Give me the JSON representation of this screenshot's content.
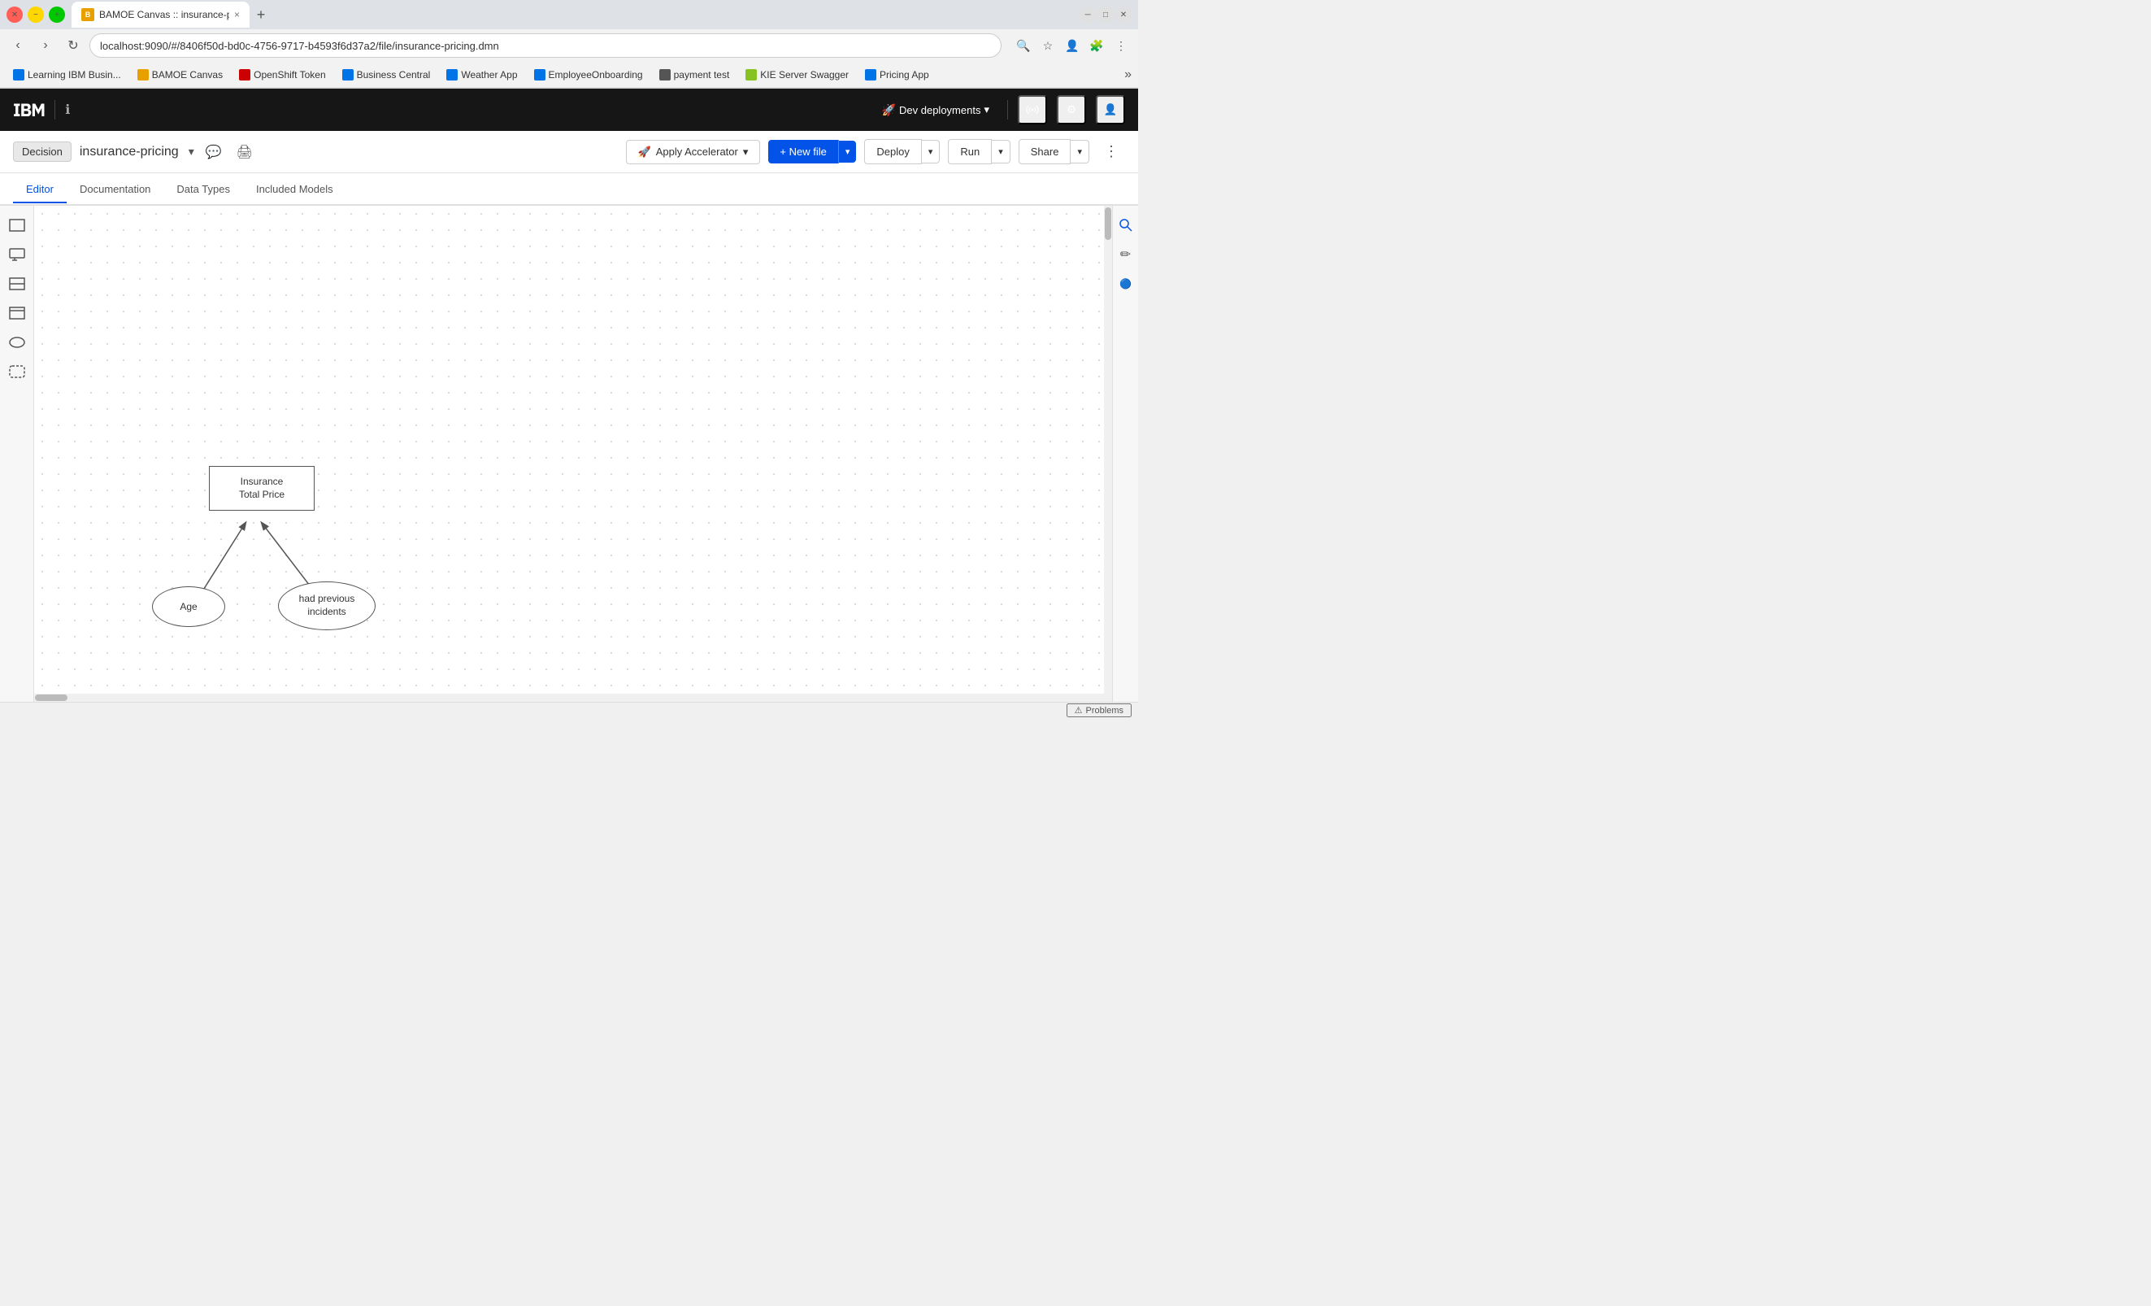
{
  "browser": {
    "tab": {
      "favicon_text": "B",
      "title": "BAMOE Canvas :: insurance-pri...",
      "close_label": "×"
    },
    "new_tab_label": "+",
    "address": "localhost:9090/#/8406f50d-bd0c-4756-9717-b4593f6d37a2/file/insurance-pricing.dmn",
    "nav": {
      "back": "‹",
      "forward": "›",
      "refresh": "↻"
    }
  },
  "bookmarks": [
    {
      "id": "learning",
      "label": "Learning IBM Busin...",
      "color": "#0073e6"
    },
    {
      "id": "bamoe",
      "label": "BAMOE Canvas",
      "color": "#e8a000"
    },
    {
      "id": "openshift",
      "label": "OpenShift Token",
      "color": "#cc0000"
    },
    {
      "id": "business",
      "label": "Business Central",
      "color": "#0073e6"
    },
    {
      "id": "weather",
      "label": "Weather App",
      "color": "#0073e6"
    },
    {
      "id": "employee",
      "label": "EmployeeOnboarding",
      "color": "#0073e6"
    },
    {
      "id": "payment",
      "label": "payment test",
      "color": "#555"
    },
    {
      "id": "kie",
      "label": "KIE Server Swagger",
      "color": "#85c222"
    },
    {
      "id": "pricing",
      "label": "Pricing App",
      "color": "#0073e6"
    }
  ],
  "app_header": {
    "logo": "IBM",
    "dev_deployments_label": "Dev deployments",
    "dev_deployments_caret": "▾"
  },
  "toolbar": {
    "decision_label": "Decision",
    "file_name": "insurance-pricing",
    "dropdown_caret": "▾",
    "accelerator_label": "Apply Accelerator",
    "accelerator_caret": "▾",
    "new_file_label": "+ New file",
    "new_file_caret": "▾",
    "deploy_label": "Deploy",
    "deploy_caret": "▾",
    "run_label": "Run",
    "run_caret": "▾",
    "share_label": "Share",
    "share_caret": "▾",
    "kebab": "⋮"
  },
  "tabs": [
    {
      "id": "editor",
      "label": "Editor",
      "active": true
    },
    {
      "id": "documentation",
      "label": "Documentation",
      "active": false
    },
    {
      "id": "datatypes",
      "label": "Data Types",
      "active": false
    },
    {
      "id": "included",
      "label": "Included Models",
      "active": false
    }
  ],
  "diagram": {
    "decision_box_label": "Insurance\nTotal Price",
    "age_label": "Age",
    "incidents_label": "had previous\nincidents"
  },
  "status": {
    "problems_label": "Problems"
  }
}
